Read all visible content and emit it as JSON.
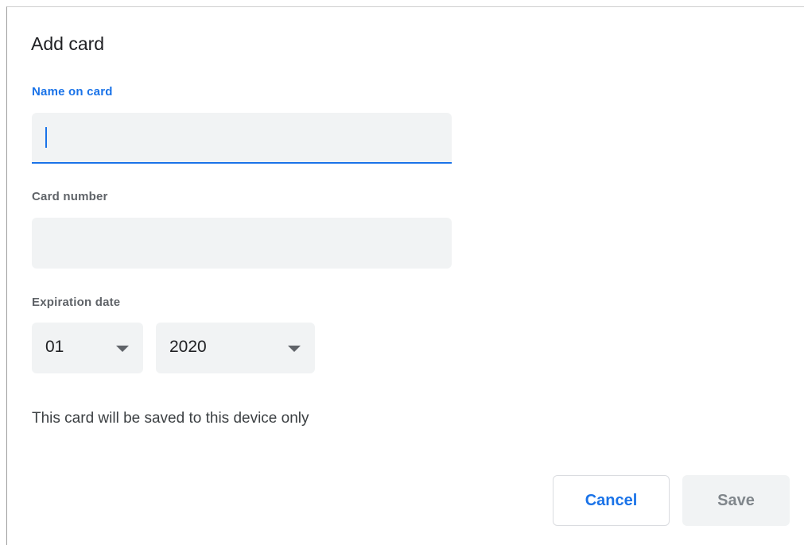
{
  "dialog": {
    "title": "Add card",
    "name_field": {
      "label": "Name on card",
      "value": ""
    },
    "number_field": {
      "label": "Card number",
      "value": ""
    },
    "expiration": {
      "label": "Expiration date",
      "month": "01",
      "year": "2020"
    },
    "note": "This card will be saved to this device only",
    "buttons": {
      "cancel": "Cancel",
      "save": "Save"
    },
    "colors": {
      "accent": "#1a73e8",
      "field_bg": "#f1f3f4",
      "disabled_text": "#80868b"
    }
  }
}
